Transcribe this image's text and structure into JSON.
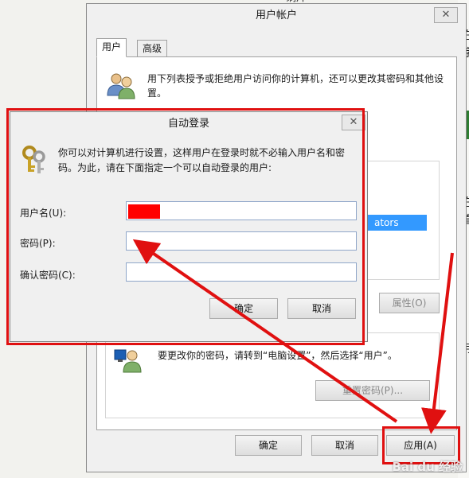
{
  "background": {
    "top_text": "刷片",
    "side_chars": [
      "在",
      "字",
      "在",
      "直",
      "弓"
    ]
  },
  "user_accounts": {
    "title": "用户帐户",
    "close": "✕",
    "tabs": [
      {
        "label": "用户"
      },
      {
        "label": "高级"
      }
    ],
    "intro_text": "用下列表授予或拒绝用户访问你的计算机，还可以更改其密码和其他设置。",
    "list_item_partial": "ators",
    "properties_label": "属性(O)",
    "password_note": "要更改你的密码，请转到“电脑设置”，然后选择“用户”。",
    "reset_password_label": "重置密码(P)...",
    "ok_label": "确定",
    "cancel_label": "取消",
    "apply_label": "应用(A)"
  },
  "auto_login": {
    "title": "自动登录",
    "close": "✕",
    "description": "你可以对计算机进行设置，这样用户在登录时就不必输入用户名和密码。为此，请在下面指定一个可以自动登录的用户:",
    "username_label": "用户名(U):",
    "username_value": "",
    "password_label": "密码(P):",
    "password_value": "",
    "confirm_label": "确认密码(C):",
    "confirm_value": "",
    "ok_label": "确定",
    "cancel_label": "取消"
  },
  "watermark": "Bai du 经验",
  "colors": {
    "annotation_red": "#e01010",
    "selection_blue": "#3399ff"
  }
}
